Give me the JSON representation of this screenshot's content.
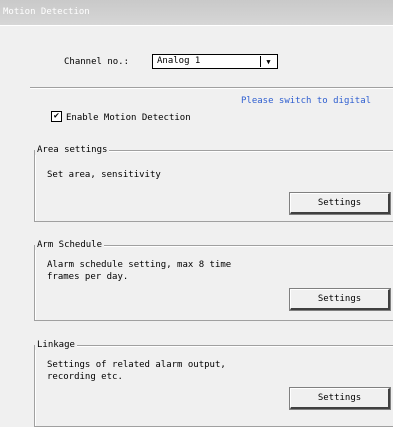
{
  "window": {
    "title": "Motion Detection"
  },
  "channel": {
    "label": "Channel no.:",
    "selected": "Analog 1"
  },
  "hint": "Please switch to digital",
  "enable": {
    "checked": true,
    "label": "Enable Motion Detection"
  },
  "groups": [
    {
      "title": "Area settings",
      "description": "Set area, sensitivity",
      "button": "Settings"
    },
    {
      "title": "Arm Schedule",
      "description": "Alarm schedule setting, max 8 time\nframes per day.",
      "button": "Settings"
    },
    {
      "title": "Linkage",
      "description": "Settings of related alarm output,\nrecording etc.",
      "button": "Settings"
    }
  ]
}
